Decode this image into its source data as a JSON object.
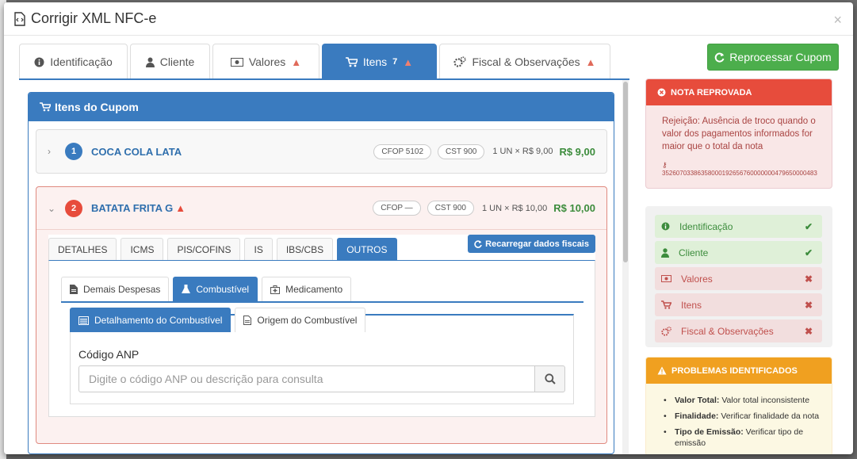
{
  "modal": {
    "title": "Corrigir XML NFC-e",
    "close": "×"
  },
  "tabs": [
    {
      "label": "Identificação",
      "icon": "info-circle-icon",
      "warn": ""
    },
    {
      "label": "Cliente",
      "icon": "user-icon",
      "warn": ""
    },
    {
      "label": "Valores",
      "icon": "money-icon",
      "warn": "▲"
    },
    {
      "label": "Itens",
      "icon": "cart-icon",
      "count": "7",
      "warn": "▲"
    },
    {
      "label": "Fiscal & Observações",
      "icon": "cogs-icon",
      "warn": "▲"
    }
  ],
  "reprocess_label": "Reprocessar Cupom",
  "panel": {
    "title": "Itens do Cupom"
  },
  "items": [
    {
      "num": "1",
      "name": "COCA COLA LATA",
      "cfop": "CFOP 5102",
      "cst": "CST 900",
      "qty": "1 UN × R$ 9,00",
      "price": "R$ 9,00",
      "collapsed_icon": "›"
    },
    {
      "num": "2",
      "name": "BATATA FRITA G",
      "warn": "▲",
      "cfop": "CFOP —",
      "cst": "CST 900",
      "qty": "1 UN × R$ 10,00",
      "price": "R$ 10,00",
      "collapsed_icon": "⌄"
    }
  ],
  "subtabs": [
    "DETALHES",
    "ICMS",
    "PIS/COFINS",
    "IS",
    "IBS/CBS",
    "OUTROS"
  ],
  "reload_label": "Recarregar dados fiscais",
  "outros_tabs": [
    "Demais Despesas",
    "Combustível",
    "Medicamento"
  ],
  "combustivel_tabs": [
    "Detalhamento do Combustível",
    "Origem do Combustível"
  ],
  "anp": {
    "label": "Código ANP",
    "placeholder": "Digite o código ANP ou descrição para consulta"
  },
  "alert": {
    "title": "NOTA REPROVADA",
    "text": "Rejeição: Ausência de troco quando o valor dos pagamentos informados for maior que o total da nota",
    "key": "35260703386358000192656760000000479650000483"
  },
  "checklist": [
    {
      "label": "Identificação",
      "status": "ok",
      "mark": "✔",
      "icon": "info-circle-icon"
    },
    {
      "label": "Cliente",
      "status": "ok",
      "mark": "✔",
      "icon": "user-icon"
    },
    {
      "label": "Valores",
      "status": "bad",
      "mark": "✖",
      "icon": "money-icon"
    },
    {
      "label": "Itens",
      "status": "bad",
      "mark": "✖",
      "icon": "cart-icon"
    },
    {
      "label": "Fiscal & Observações",
      "status": "bad",
      "mark": "✖",
      "icon": "cogs-icon"
    }
  ],
  "problems": {
    "title": "PROBLEMAS IDENTIFICADOS",
    "items": [
      {
        "key": "Valor Total:",
        "text": "Valor total inconsistente"
      },
      {
        "key": "Finalidade:",
        "text": "Verificar finalidade da nota"
      },
      {
        "key": "Tipo de Emissão:",
        "text": "Verificar tipo de emissão"
      }
    ]
  },
  "colors": {
    "primary": "#3a7bbf",
    "success": "#4cae4c",
    "danger": "#e74c3c",
    "warning": "#f0a020"
  }
}
